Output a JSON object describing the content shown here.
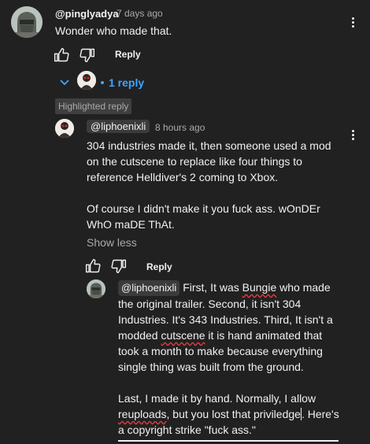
{
  "comment": {
    "author": "@pinglyadya",
    "time": "7 days ago",
    "text": "Wonder who made that.",
    "reply_label": "Reply",
    "replies_count_label": "1 reply"
  },
  "reply1": {
    "highlight_badge": "Highlighted reply",
    "author": "@liphoenixli",
    "time": "8 hours ago",
    "paragraph1": "304 industries made it, then someone used a mod on the cutscene to replace like four things to reference Helldiver's 2 coming to Xbox.",
    "paragraph2": "Of course I didn't make it you fuck ass. wOnDEr WhO maDE ThAt.",
    "show_less": "Show less",
    "reply_label": "Reply"
  },
  "composer": {
    "mention": "@liphoenixli",
    "line1_a": "First, It was ",
    "line1_misspelled": "Bungie",
    "line1_b": " who made",
    "line2": "the original trailer. Second, it isn't 304",
    "line3": "Industries. It's 343 Industries. Third, It isn't a",
    "line4_a": "modded ",
    "line4_misspelled": "cutscene",
    "line4_b": " it is hand animated that",
    "line5": "took a month to make because everything",
    "line6": "single thing was built from the ground.",
    "line7": "Last, I made it by hand. Normally, I allow",
    "line8_misspelled": "reuploads",
    "line8_b": ", but you lost that priviledge",
    "line8_c": ". Here's",
    "line9": "a copyright strike \"fuck ass.\""
  },
  "colors": {
    "background": "#212121",
    "accent_blue": "#3ea6ff",
    "text": "#f1f1f1",
    "muted": "#aaaaaa",
    "spell_error": "#e03b3b"
  }
}
